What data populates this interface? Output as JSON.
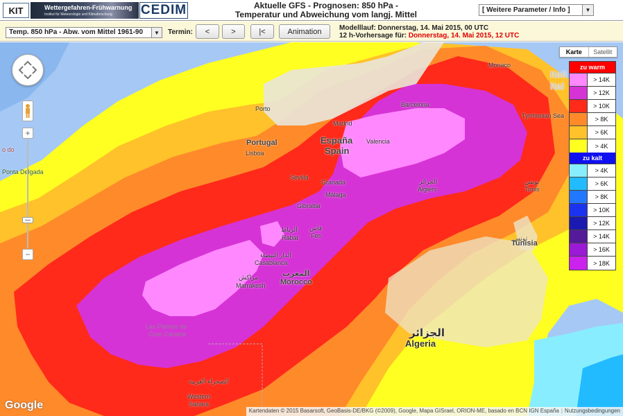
{
  "header": {
    "logo_kit": "KIT",
    "logo_wfw_title": "Wettergefahren-Frühwarnung",
    "logo_wfw_sub": "Institut für Meteorologie und Klimaforschung",
    "logo_cedim": "CEDIM",
    "title_line1": "Aktuelle GFS - Prognosen: 850 hPa -",
    "title_line2": "Temperatur und Abweichung vom langj. Mittel",
    "param_select": "[ Weitere Parameter / Info ]"
  },
  "controls": {
    "product_select": "Temp. 850 hPa - Abw. vom Mittel 1961-90",
    "termin_label": "Termin:",
    "btn_prev": "<",
    "btn_next": ">",
    "btn_first": "|<",
    "btn_animation": "Animation",
    "modelllauf_label": "Modelllauf: Donnerstag, 14. Mai 2015, 00 UTC",
    "forecast_label": "12 h-Vorhersage für: ",
    "forecast_value": "Donnerstag, 14. Mai 2015, 12 UTC"
  },
  "maptype": {
    "karte": "Karte",
    "satellit": "Satellit"
  },
  "legend": {
    "warm_title": "zu warm",
    "warm": [
      {
        "label": "> 14K",
        "color": "#ff88ff"
      },
      {
        "label": "> 12K",
        "color": "#d633d6"
      },
      {
        "label": "> 10K",
        "color": "#ff2a1a"
      },
      {
        "label": "> 8K",
        "color": "#ff8a2a"
      },
      {
        "label": "> 6K",
        "color": "#ffc22a"
      },
      {
        "label": "> 4K",
        "color": "#ffff22"
      }
    ],
    "cold_title": "zu kalt",
    "cold": [
      {
        "label": "> 4K",
        "color": "#88eeff"
      },
      {
        "label": "> 6K",
        "color": "#22bbff"
      },
      {
        "label": "> 8K",
        "color": "#2277ff"
      },
      {
        "label": "> 10K",
        "color": "#1a33ee"
      },
      {
        "label": "> 12K",
        "color": "#1a1ab0"
      },
      {
        "label": "> 14K",
        "color": "#551a99"
      },
      {
        "label": "> 16K",
        "color": "#9a1ad6"
      },
      {
        "label": "> 18K",
        "color": "#cc22ee"
      }
    ]
  },
  "places": {
    "porto": "Porto",
    "portugal": "Portugal",
    "lisboa": "Lisboa",
    "madrid": "Madrid",
    "espana": "España",
    "spain": "Spain",
    "valencia": "Valencia",
    "barcelona": "Barcelona",
    "sevilla": "Sevilla",
    "granada": "Granada",
    "malaga": "Málaga",
    "gibraltar": "Gibraltar",
    "fes_ar": "فاس",
    "fes": "Fes",
    "rabat_ar": "الرباط",
    "rabat": "Rabat",
    "casablanca_ar": "الدار البيضاء",
    "casablanca": "Casablanca",
    "marrakesh_ar": "مراكش",
    "marrakesh": "Marrakesh",
    "morocco_ar": "المغرب",
    "morocco": "Morocco",
    "algiers_ar": "الجزائر",
    "algiers": "Algiers",
    "algeria_ar": "الجزائر",
    "algeria": "Algeria",
    "tunis_ar": "تونس",
    "tunis": "Tunis",
    "tunisia_ar": "تونس",
    "tunisia": "Tunisia",
    "monaco": "Monaco",
    "italia": "Itali",
    "italy": "Ital",
    "tyrrhenian": "Tyrrhenian Sea",
    "las_palmas": "Las Palmas de",
    "gran_canaria": "Gran Canaria",
    "western_sahara_ar": "الصحراء الغربية",
    "western": "Western",
    "sahara": "Sahara",
    "ponta_delgada": "Ponta Delgada",
    "edo": "o do"
  },
  "footer": {
    "google": "Google",
    "attribution": "Kartendaten © 2015 Basarsoft, GeoBasis-DE/BKG (©2009), Google, Mapa GISrael, ORION-ME, basado en BCN IGN España",
    "terms": "Nutzungsbedingungen"
  }
}
